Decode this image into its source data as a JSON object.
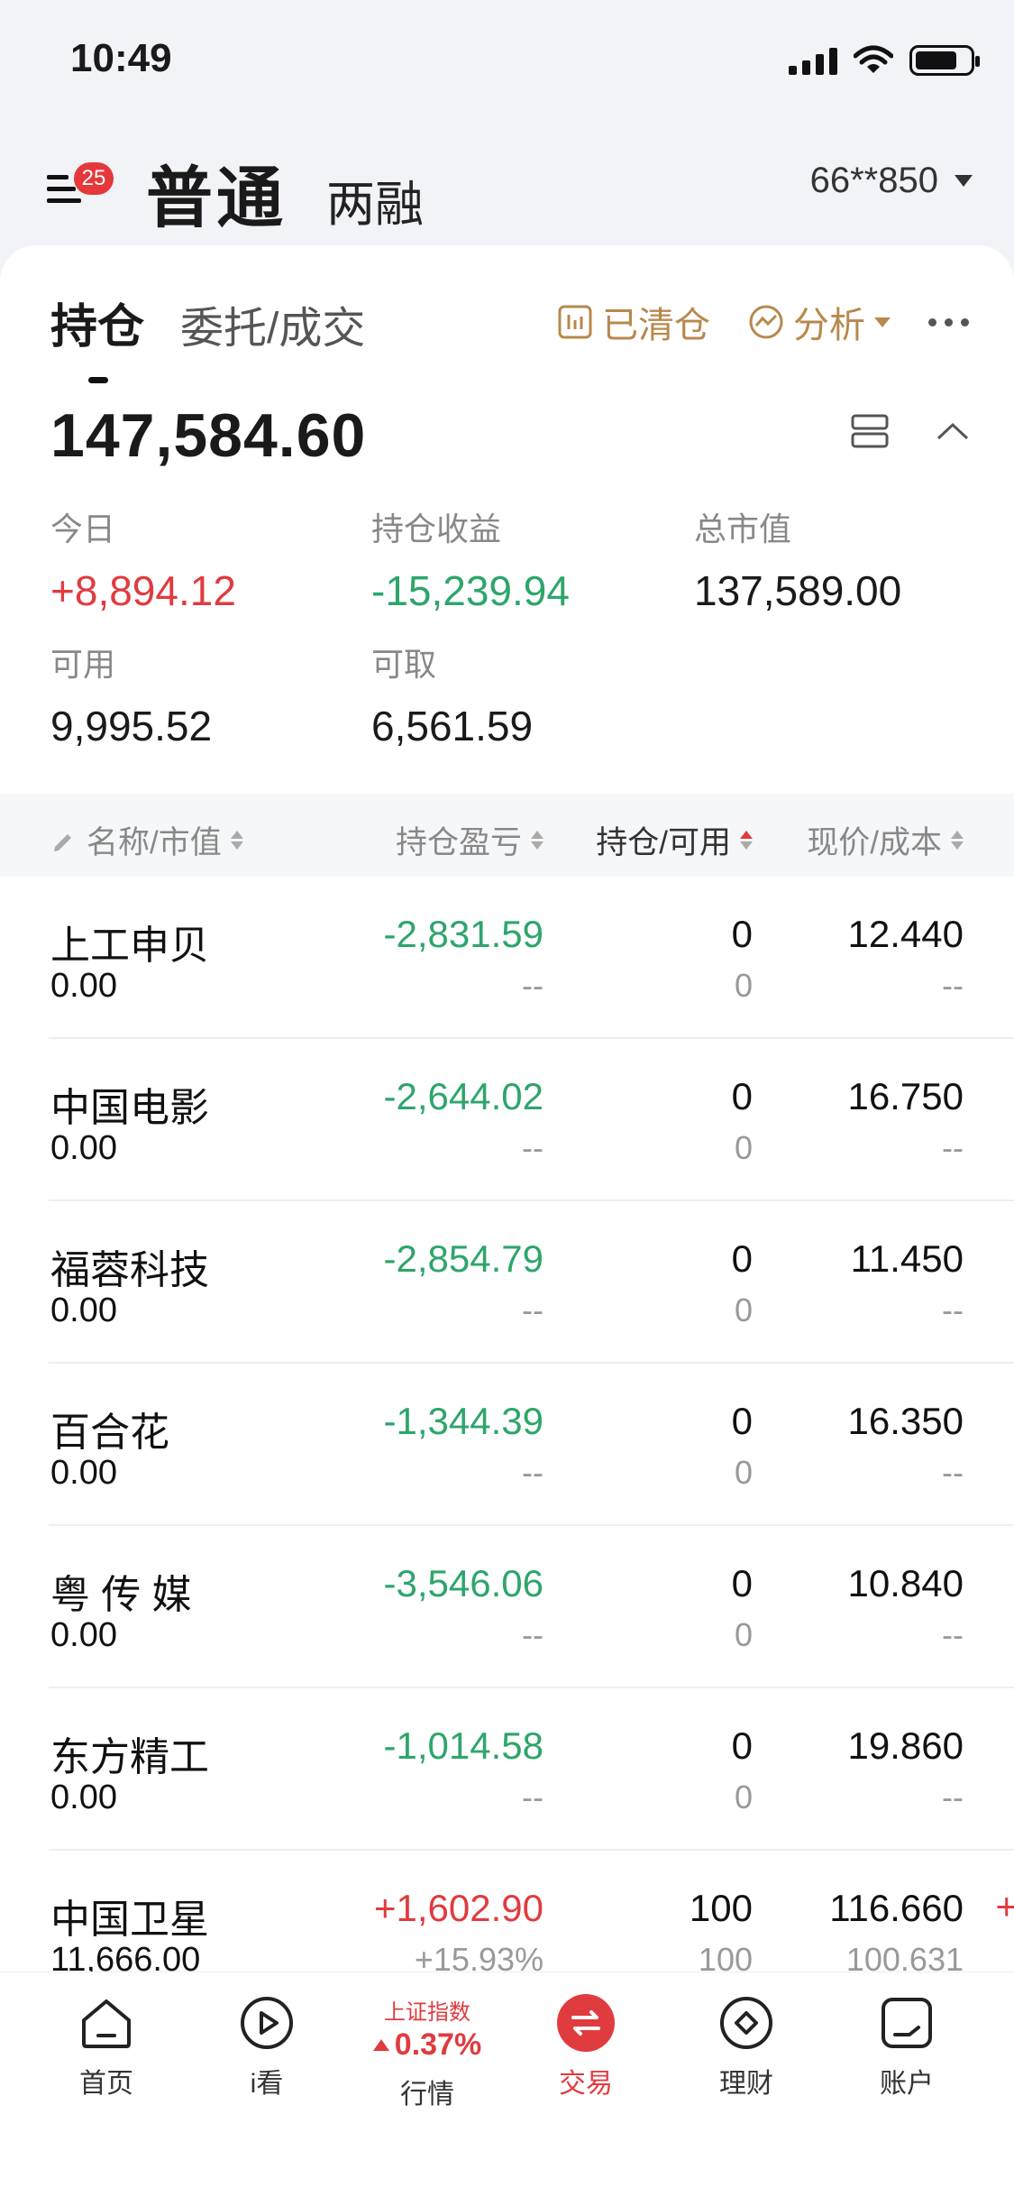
{
  "status": {
    "time": "10:49"
  },
  "account": {
    "badge": "25",
    "main_tab": "普通",
    "margin_tab": "两融",
    "account_id": "66**850"
  },
  "tabs": {
    "active": "持仓",
    "other": "委托/成交"
  },
  "tools": {
    "cleared": "已清仓",
    "analysis": "分析"
  },
  "summary": {
    "total": "147,584.60",
    "today_label": "今日",
    "today_value": "+8,894.12",
    "profit_label": "持仓收益",
    "profit_value": "-15,239.94",
    "market_label": "总市值",
    "market_value": "137,589.00",
    "available_label": "可用",
    "available_value": "9,995.52",
    "withdrawable_label": "可取",
    "withdrawable_value": "6,561.59"
  },
  "table": {
    "headers": {
      "name": "名称/市值",
      "pl": "持仓盈亏",
      "hold": "持仓/可用",
      "price": "现价/成本"
    },
    "rows": [
      {
        "name": "上工申贝",
        "mv": "0.00",
        "pl": "-2,831.59",
        "pl_pct": "--",
        "hold": "0",
        "avail": "0",
        "price": "12.440",
        "cost": "--",
        "pl_color": "green"
      },
      {
        "name": "中国电影",
        "mv": "0.00",
        "pl": "-2,644.02",
        "pl_pct": "--",
        "hold": "0",
        "avail": "0",
        "price": "16.750",
        "cost": "--",
        "pl_color": "green"
      },
      {
        "name": "福蓉科技",
        "mv": "0.00",
        "pl": "-2,854.79",
        "pl_pct": "--",
        "hold": "0",
        "avail": "0",
        "price": "11.450",
        "cost": "--",
        "pl_color": "green"
      },
      {
        "name": "百合花",
        "mv": "0.00",
        "pl": "-1,344.39",
        "pl_pct": "--",
        "hold": "0",
        "avail": "0",
        "price": "16.350",
        "cost": "--",
        "pl_color": "green"
      },
      {
        "name": "粤 传 媒",
        "mv": "0.00",
        "pl": "-3,546.06",
        "pl_pct": "--",
        "hold": "0",
        "avail": "0",
        "price": "10.840",
        "cost": "--",
        "pl_color": "green"
      },
      {
        "name": "东方精工",
        "mv": "0.00",
        "pl": "-1,014.58",
        "pl_pct": "--",
        "hold": "0",
        "avail": "0",
        "price": "19.860",
        "cost": "--",
        "pl_color": "green"
      },
      {
        "name": "中国卫星",
        "mv": "11,666.00",
        "pl": "+1,602.90",
        "pl_pct": "+15.93%",
        "hold": "100",
        "avail": "100",
        "price": "116.660",
        "cost": "100.631",
        "pl_color": "red",
        "edge": "+"
      }
    ]
  },
  "nav": {
    "home": "首页",
    "watch": "i看",
    "market_index": "上证指数",
    "market_change": "0.37%",
    "market": "行情",
    "trade": "交易",
    "wealth": "理财",
    "account": "账户"
  },
  "colors": {
    "up": "#e03b3f",
    "down": "#2ea56b",
    "accent": "#b8884d"
  }
}
